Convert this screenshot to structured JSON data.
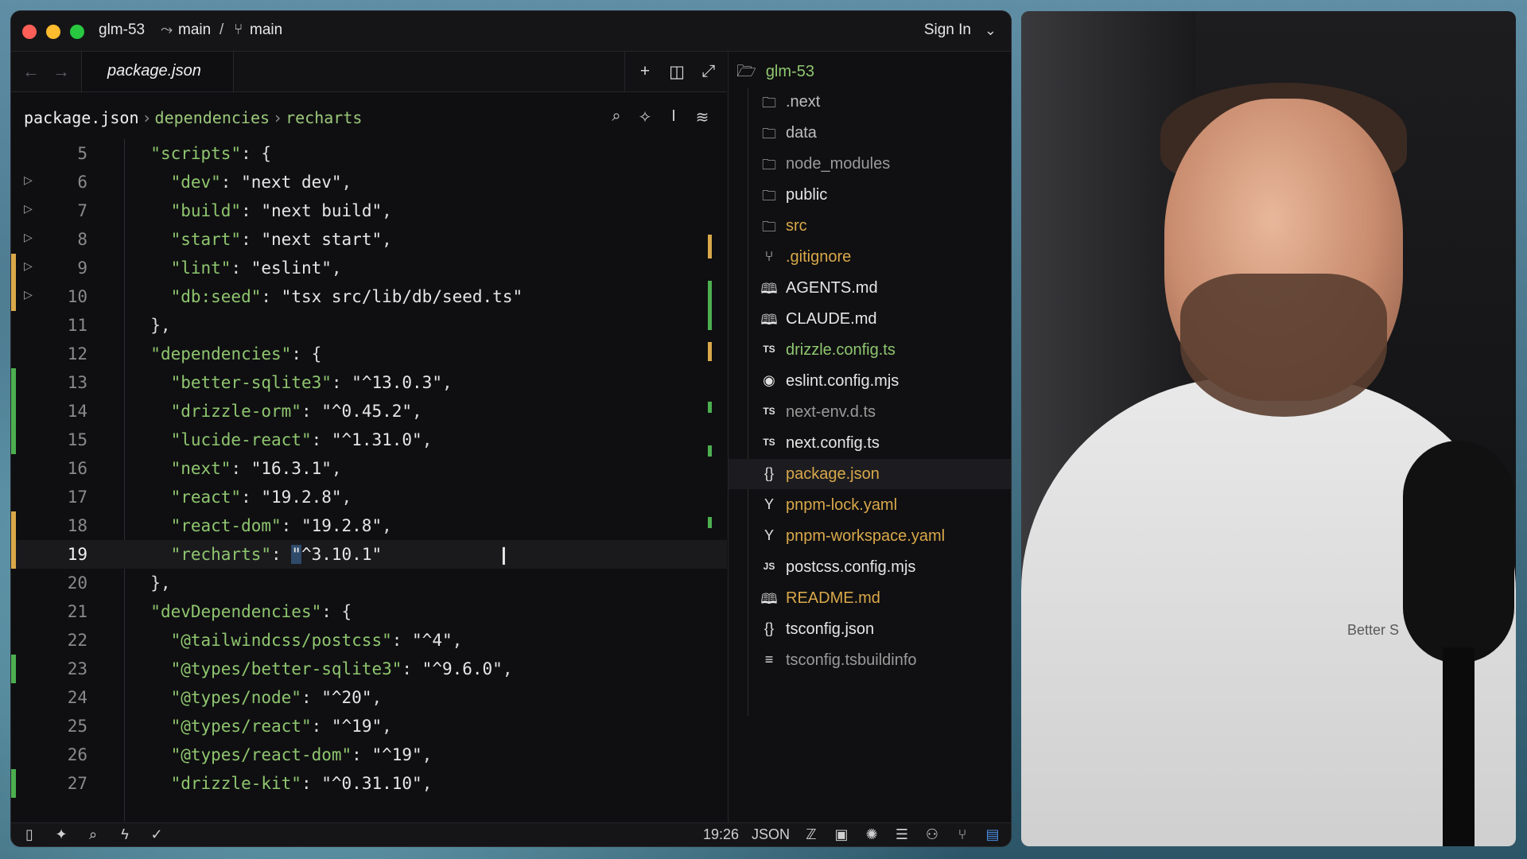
{
  "titlebar": {
    "project": "glm-53",
    "branch_a": "main",
    "branch_sep": "/",
    "branch_b": "main",
    "sign_in": "Sign In"
  },
  "tab": {
    "label": "package.json"
  },
  "breadcrumb": {
    "file": "package.json",
    "sep1": "›",
    "path1": "dependencies",
    "sep2": "›",
    "path2": "recharts"
  },
  "code_lines": [
    {
      "n": "5",
      "text": "  \"scripts\": {"
    },
    {
      "n": "6",
      "text": "    \"dev\": \"next dev\","
    },
    {
      "n": "7",
      "text": "    \"build\": \"next build\","
    },
    {
      "n": "8",
      "text": "    \"start\": \"next start\","
    },
    {
      "n": "9",
      "text": "    \"lint\": \"eslint\","
    },
    {
      "n": "10",
      "text": "    \"db:seed\": \"tsx src/lib/db/seed.ts\""
    },
    {
      "n": "11",
      "text": "  },"
    },
    {
      "n": "12",
      "text": "  \"dependencies\": {"
    },
    {
      "n": "13",
      "text": "    \"better-sqlite3\": \"^13.0.3\","
    },
    {
      "n": "14",
      "text": "    \"drizzle-orm\": \"^0.45.2\","
    },
    {
      "n": "15",
      "text": "    \"lucide-react\": \"^1.31.0\","
    },
    {
      "n": "16",
      "text": "    \"next\": \"16.3.1\","
    },
    {
      "n": "17",
      "text": "    \"react\": \"19.2.8\","
    },
    {
      "n": "18",
      "text": "    \"react-dom\": \"19.2.8\","
    },
    {
      "n": "19",
      "text": "    \"recharts\": \"^3.10.1\""
    },
    {
      "n": "20",
      "text": "  },"
    },
    {
      "n": "21",
      "text": "  \"devDependencies\": {"
    },
    {
      "n": "22",
      "text": "    \"@tailwindcss/postcss\": \"^4\","
    },
    {
      "n": "23",
      "text": "    \"@types/better-sqlite3\": \"^9.6.0\","
    },
    {
      "n": "24",
      "text": "    \"@types/node\": \"^20\","
    },
    {
      "n": "25",
      "text": "    \"@types/react\": \"^19\","
    },
    {
      "n": "26",
      "text": "    \"@types/react-dom\": \"^19\","
    },
    {
      "n": "27",
      "text": "    \"drizzle-kit\": \"^0.31.10\","
    }
  ],
  "explorer": {
    "root": "glm-53",
    "items": [
      {
        "name": ".next",
        "icon": "folder-icon",
        "color": "#bdbdbd"
      },
      {
        "name": "data",
        "icon": "folder-icon",
        "color": "#bdbdbd"
      },
      {
        "name": "node_modules",
        "icon": "folder-icon",
        "color": "#9a9a9a"
      },
      {
        "name": "public",
        "icon": "folder-icon",
        "color": "#e6e6e6"
      },
      {
        "name": "src",
        "icon": "folder-icon",
        "color": "#d9a84a"
      },
      {
        "name": ".gitignore",
        "icon": "git-icon",
        "color": "#d9a84a"
      },
      {
        "name": "AGENTS.md",
        "icon": "book-icon",
        "color": "#e6e6e6"
      },
      {
        "name": "CLAUDE.md",
        "icon": "book-icon",
        "color": "#e6e6e6"
      },
      {
        "name": "drizzle.config.ts",
        "icon": "ts-icon",
        "color": "#8fc66f"
      },
      {
        "name": "eslint.config.mjs",
        "icon": "eslint-icon",
        "color": "#e6e6e6"
      },
      {
        "name": "next-env.d.ts",
        "icon": "ts-icon",
        "color": "#9a9a9a"
      },
      {
        "name": "next.config.ts",
        "icon": "ts-icon",
        "color": "#e6e6e6"
      },
      {
        "name": "package.json",
        "icon": "braces-icon",
        "color": "#d9a84a"
      },
      {
        "name": "pnpm-lock.yaml",
        "icon": "yaml-icon",
        "color": "#d9a84a"
      },
      {
        "name": "pnpm-workspace.yaml",
        "icon": "yaml-icon",
        "color": "#d9a84a"
      },
      {
        "name": "postcss.config.mjs",
        "icon": "js-icon",
        "color": "#e6e6e6"
      },
      {
        "name": "README.md",
        "icon": "book-icon",
        "color": "#d9a84a"
      },
      {
        "name": "tsconfig.json",
        "icon": "braces-icon",
        "color": "#e6e6e6"
      },
      {
        "name": "tsconfig.tsbuildinfo",
        "icon": "lines-icon",
        "color": "#9a9a9a"
      }
    ]
  },
  "statusbar": {
    "position": "19:26",
    "language": "JSON"
  },
  "webcam": {
    "shirt_logo": "Better S"
  }
}
